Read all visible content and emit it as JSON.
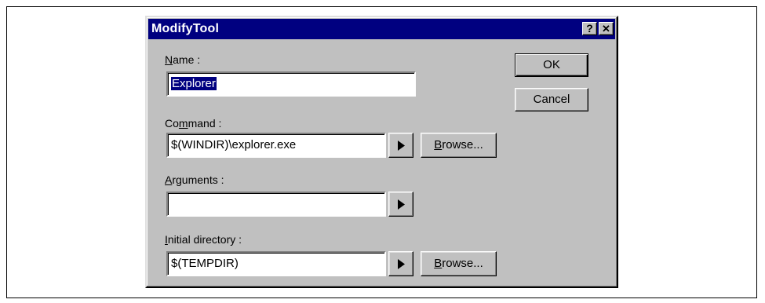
{
  "dialog": {
    "title": "ModifyTool",
    "help_label": "?",
    "close_label": "✕"
  },
  "name": {
    "label_accel": "N",
    "label_rest": "ame :",
    "value": "Explorer"
  },
  "command": {
    "label_pre": "Co",
    "label_accel": "m",
    "label_rest": "mand :",
    "value": "$(WINDIR)\\explorer.exe"
  },
  "arguments": {
    "label_accel": "A",
    "label_rest": "rguments :",
    "value": ""
  },
  "initial_directory": {
    "label_accel": "I",
    "label_rest": "nitial directory :",
    "value": "$(TEMPDIR)"
  },
  "buttons": {
    "ok": "OK",
    "cancel": "Cancel",
    "browse_accel": "B",
    "browse_rest": "rowse..."
  },
  "icons": {
    "insert_macro": "right-triangle-icon"
  }
}
